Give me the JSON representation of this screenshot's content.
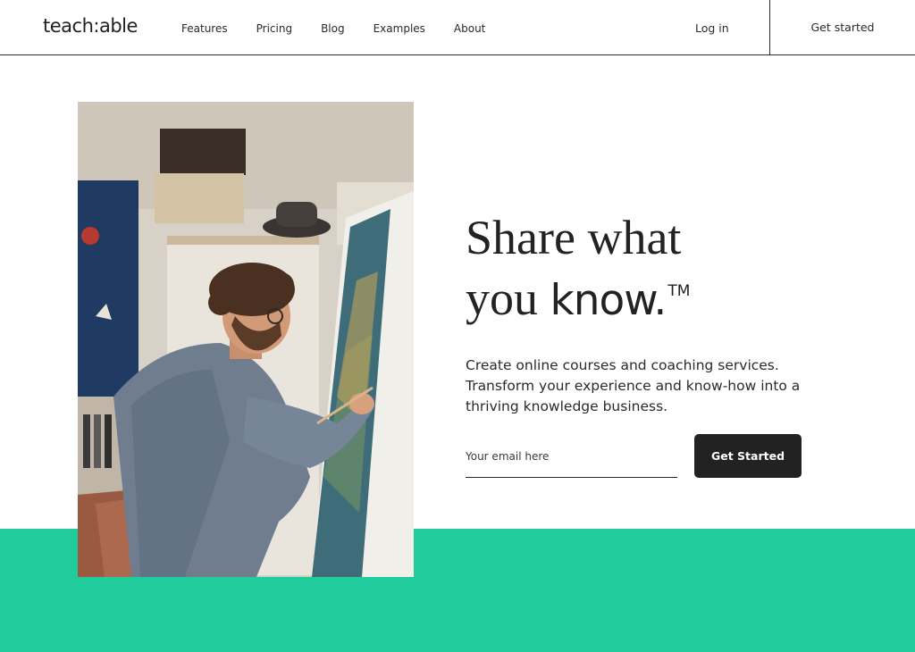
{
  "header": {
    "logo": "teach:able",
    "nav": [
      "Features",
      "Pricing",
      "Blog",
      "Examples",
      "About"
    ],
    "login_label": "Log in",
    "get_started_label": "Get started"
  },
  "hero": {
    "headline_line1": "Share what",
    "headline_line2_serif": "you ",
    "headline_line2_bold": "know.",
    "trademark": "TM",
    "subtext": "Create online courses and coaching services. Transform your experience and know-how into a thriving knowledge business.",
    "email_placeholder": "Your email here",
    "cta_label": "Get Started"
  },
  "colors": {
    "accent_green": "#20cc9b",
    "dark": "#222222"
  }
}
